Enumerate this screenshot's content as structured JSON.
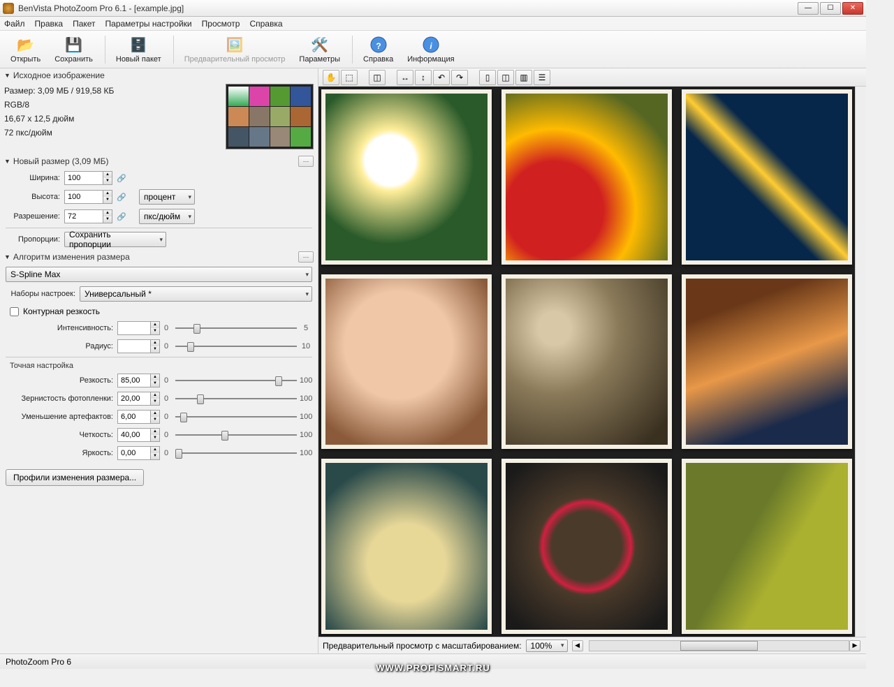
{
  "titlebar": {
    "title": "BenVista PhotoZoom Pro 6.1 - [example.jpg]"
  },
  "menu": {
    "file": "Файл",
    "edit": "Правка",
    "batch": "Пакет",
    "params": "Параметры настройки",
    "view": "Просмотр",
    "help": "Справка"
  },
  "toolbar": {
    "open": "Открыть",
    "save": "Сохранить",
    "batch": "Новый пакет",
    "preview": "Предварительный просмотр",
    "params": "Параметры",
    "help": "Справка",
    "info": "Информация"
  },
  "source": {
    "header": "Исходное изображение",
    "size": "Размер: 3,09 МБ / 919,58 КБ",
    "mode": "RGB/8",
    "dims": "16,67 x 12,5 дюйм",
    "res": "72 пкс/дюйм"
  },
  "newsize": {
    "header": "Новый размер (3,09 МБ)",
    "width_label": "Ширина:",
    "width": "100",
    "height_label": "Высота:",
    "height": "100",
    "unit": "процент",
    "res_label": "Разрешение:",
    "res": "72",
    "res_unit": "пкс/дюйм",
    "aspect_label": "Пропорции:",
    "aspect": "Сохранить пропорции"
  },
  "algo": {
    "header": "Алгоритм изменения размера",
    "method": "S-Spline Max",
    "preset_label": "Наборы настроек:",
    "preset": "Универсальный *",
    "contour": "Контурная резкость",
    "intensity_label": "Интенсивность:",
    "intensity": "",
    "intensity_min": "0",
    "intensity_max": "5",
    "radius_label": "Радиус:",
    "radius": "",
    "radius_min": "0",
    "radius_max": "10",
    "fine_header": "Точная настройка",
    "sharp_label": "Резкость:",
    "sharp": "85,00",
    "sharp_min": "0",
    "sharp_max": "100",
    "grain_label": "Зернистость фотопленки:",
    "grain": "20,00",
    "grain_min": "0",
    "grain_max": "100",
    "artifact_label": "Уменьшение артефактов:",
    "artifact": "6,00",
    "artifact_min": "0",
    "artifact_max": "100",
    "crisp_label": "Четкость:",
    "crisp": "40,00",
    "crisp_min": "0",
    "crisp_max": "100",
    "vivid_label": "Яркость:",
    "vivid": "0,00",
    "vivid_min": "0",
    "vivid_max": "100",
    "profiles_btn": "Профили изменения размера..."
  },
  "previewbar": {
    "zoom_label": "Предварительный просмотр с масштабированием:",
    "zoom": "100%"
  },
  "status": {
    "app": "PhotoZoom Pro 6"
  },
  "watermark": "WWW.PROFISMART.RU"
}
